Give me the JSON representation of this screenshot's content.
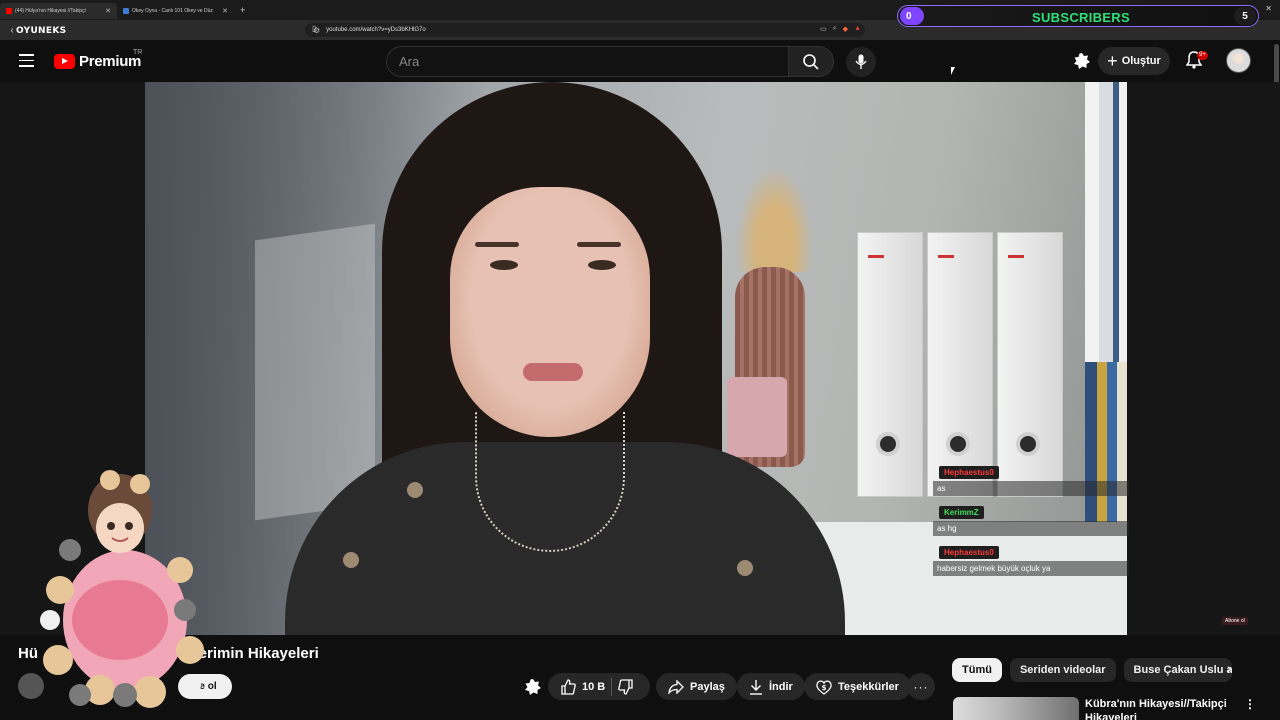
{
  "browser": {
    "tabs": [
      {
        "label": "(44) Hülya'nın Hikayesi //Takipçi",
        "active": true
      },
      {
        "label": "Okey Oyna - Canlı 101 Okey ve Düz",
        "active": false
      }
    ],
    "new_tab": "+",
    "url": "youtube.com/watch?v=yDs3bKHlG7o"
  },
  "overlay": {
    "logo_text": "OYUNEKS",
    "subscribers_label": "SUBSCRIBERS",
    "subscribers_left": "0",
    "subscribers_right": "5"
  },
  "header": {
    "brand": "Premium",
    "region": "TR",
    "search_placeholder": "Ara",
    "create_label": "Oluştur",
    "notifications_badge": "9+"
  },
  "chat": [
    {
      "name": "Hephaestus0",
      "name_color": "#ff3b3b",
      "text": "as"
    },
    {
      "name": "KerimmZ",
      "name_color": "#44e05c",
      "text": "as hg"
    },
    {
      "name": "Hephaestus0",
      "name_color": "#ff3b3b",
      "text": "habersiz gelmek büyük oçluk ya"
    }
  ],
  "video": {
    "title": "Hü... ...cilerimin Hikayeleri",
    "title_start": "Hü",
    "title_end": "cilerimin Hikayeleri",
    "subscribe_label": "ne ol",
    "abone_badge": "Abone ol",
    "like_count": "10 B",
    "share_label": "Paylaş",
    "download_label": "İndir",
    "thanks_label": "Teşekkürler",
    "more_label": "···"
  },
  "sidebar": {
    "chips": [
      {
        "label": "Tümü",
        "active": true
      },
      {
        "label": "Seriden videolar",
        "active": false
      },
      {
        "label": "Buse Çakan Uslu adlı",
        "active": false
      }
    ],
    "recommendation": {
      "title": "Kübra'nın Hikayesi//Takipçi Hikayeleri"
    }
  }
}
